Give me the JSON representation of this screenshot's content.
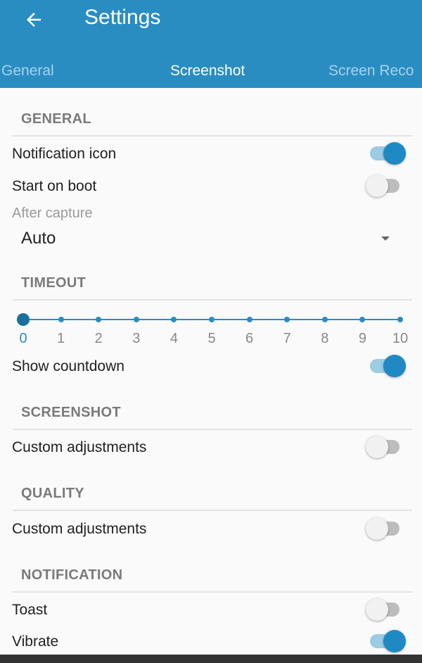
{
  "app_bar": {
    "title": "Settings"
  },
  "tabs": [
    {
      "label": "General",
      "active": false
    },
    {
      "label": "Screenshot",
      "active": true
    },
    {
      "label": "Screen Reco",
      "active": false
    }
  ],
  "general": {
    "header": "GENERAL",
    "notification_icon": {
      "label": "Notification icon",
      "on": true
    },
    "start_on_boot": {
      "label": "Start on boot",
      "on": false
    },
    "after_capture": {
      "label": "After capture",
      "value": "Auto"
    }
  },
  "timeout": {
    "header": "TIMEOUT",
    "slider": {
      "min": 0,
      "max": 10,
      "value": 0,
      "labels": [
        "0",
        "1",
        "2",
        "3",
        "4",
        "5",
        "6",
        "7",
        "8",
        "9",
        "10"
      ]
    },
    "show_countdown": {
      "label": "Show countdown",
      "on": true
    }
  },
  "screenshot": {
    "header": "SCREENSHOT",
    "custom_adjustments": {
      "label": "Custom adjustments",
      "on": false
    }
  },
  "quality": {
    "header": "QUALITY",
    "custom_adjustments": {
      "label": "Custom adjustments",
      "on": false
    }
  },
  "notification": {
    "header": "NOTIFICATION",
    "toast": {
      "label": "Toast",
      "on": false
    },
    "vibrate": {
      "label": "Vibrate",
      "on": true
    }
  },
  "colors": {
    "primary": "#2a8dc2",
    "switch_on": "#1f89c3",
    "switch_off": "#f1f1f1",
    "header_text": "#7a7a7a"
  }
}
